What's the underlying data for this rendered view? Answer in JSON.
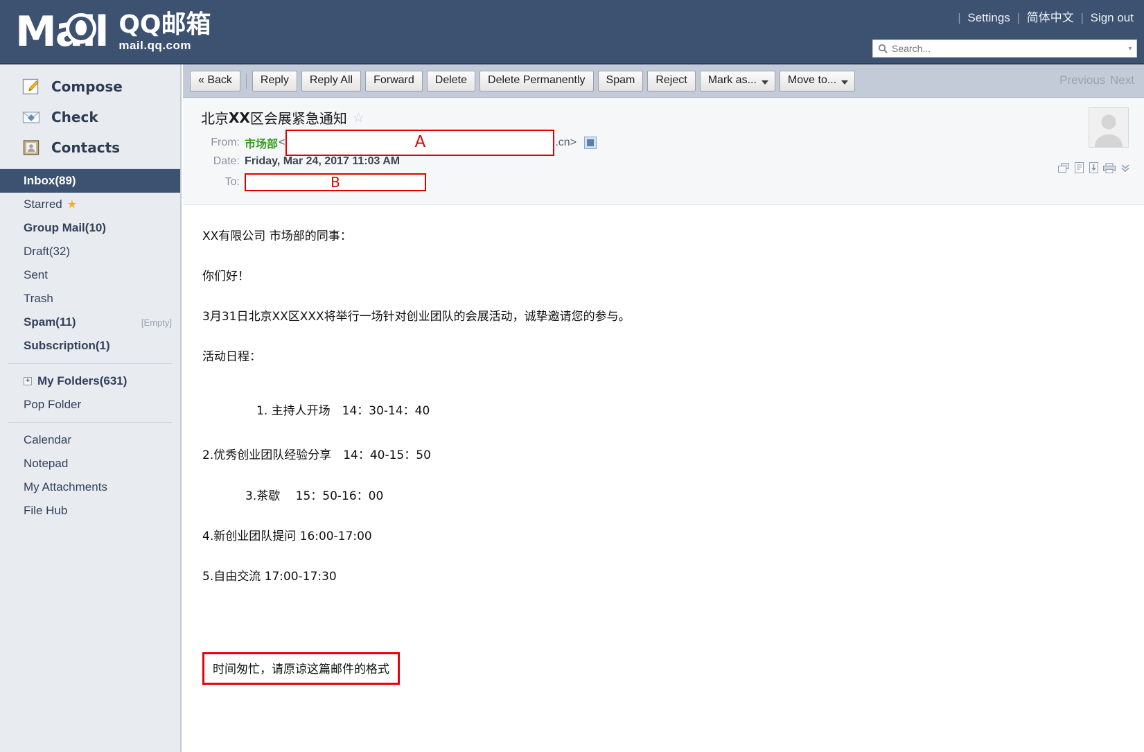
{
  "header": {
    "logo_main": "Mail",
    "logo_cn": "QQ邮箱",
    "logo_url": "mail.qq.com",
    "links": [
      {
        "label": "Settings",
        "name": "settings-link"
      },
      {
        "label": "简体中文",
        "name": "language-link"
      },
      {
        "label": "Sign out",
        "name": "sign-out-link"
      }
    ],
    "separator": "|",
    "search": {
      "placeholder": "Search...",
      "value": "",
      "icon": "search-icon",
      "caret": "▾"
    },
    "brand_color": "#3d5170"
  },
  "sidebar": {
    "quick": [
      {
        "label": "Compose",
        "icon": "compose-pencil-icon"
      },
      {
        "label": "Check",
        "icon": "envelope-check-icon"
      },
      {
        "label": "Contacts",
        "icon": "contacts-person-icon"
      }
    ],
    "folders": [
      {
        "label": "Inbox(89)",
        "active": true,
        "bold": true
      },
      {
        "label": "Starred",
        "star": "★",
        "bold": false
      },
      {
        "label": "Group Mail(10)",
        "bold": true
      },
      {
        "label": "Draft(32)",
        "bold": false
      },
      {
        "label": "Sent",
        "bold": false
      },
      {
        "label": "Trash",
        "bold": false
      },
      {
        "label": "Spam(11)",
        "bold": true,
        "tag": "[Empty]"
      },
      {
        "label": "Subscription(1)",
        "bold": true
      }
    ],
    "my_folders": {
      "label": "My Folders(631)",
      "expander": "+"
    },
    "pop_folder": {
      "label": "Pop Folder"
    },
    "tools": [
      {
        "label": "Calendar"
      },
      {
        "label": "Notepad"
      },
      {
        "label": "My Attachments"
      },
      {
        "label": "File Hub"
      }
    ]
  },
  "toolbar": {
    "back": "« Back",
    "buttons": [
      "Reply",
      "Reply All",
      "Forward",
      "Delete",
      "Delete Permanently",
      "Spam",
      "Reject"
    ],
    "dropdowns": [
      "Mark as...",
      "Move to..."
    ],
    "previous": "Previous",
    "next": "Next"
  },
  "message": {
    "subject_pre": "北京",
    "subject_bold": "XX",
    "subject_post": "区会展紧急通知",
    "star_glyph": "☆",
    "from_label": "From:",
    "from_name": "市场部",
    "from_open_angle": "<",
    "from_redacted_label": "A",
    "from_domain_suffix": ".cn>",
    "date_label": "Date:",
    "date_value": "Friday, Mar 24, 2017 11:03 AM",
    "to_label": "To:",
    "to_redacted_label": "B",
    "from_name_color": "#3a9b1f",
    "redaction_color": "#e00000",
    "head_icons": [
      "new-window-icon",
      "notes-icon",
      "save-to-drive-icon",
      "print-icon",
      "chevron-double-down-icon"
    ],
    "avatar": "avatar-placeholder-icon",
    "body": {
      "greeting_company": "XX有限公司 市场部的同事：",
      "greeting_hello": "你们好！",
      "intro": "3月31日北京XX区XXX将举行一场针对创业团队的会展活动，诚挚邀请您的参与。",
      "agenda_title": "活动日程：",
      "agenda": [
        {
          "text": "1. 主持人开场　14：30-14：40",
          "indent": "deep"
        },
        {
          "text": "2.优秀创业团队经验分享　14：40-15：50",
          "indent": "none"
        },
        {
          "text": "3.茶歇　 15：50-16：00",
          "indent": "mid"
        },
        {
          "text": "4.新创业团队提问 16:00-17:00",
          "indent": "none"
        },
        {
          "text": "5.自由交流 17:00-17:30",
          "indent": "none"
        }
      ],
      "closing_note": "时间匆忙，请原谅这篇邮件的格式",
      "closing_note_border": "#e8000d"
    }
  }
}
